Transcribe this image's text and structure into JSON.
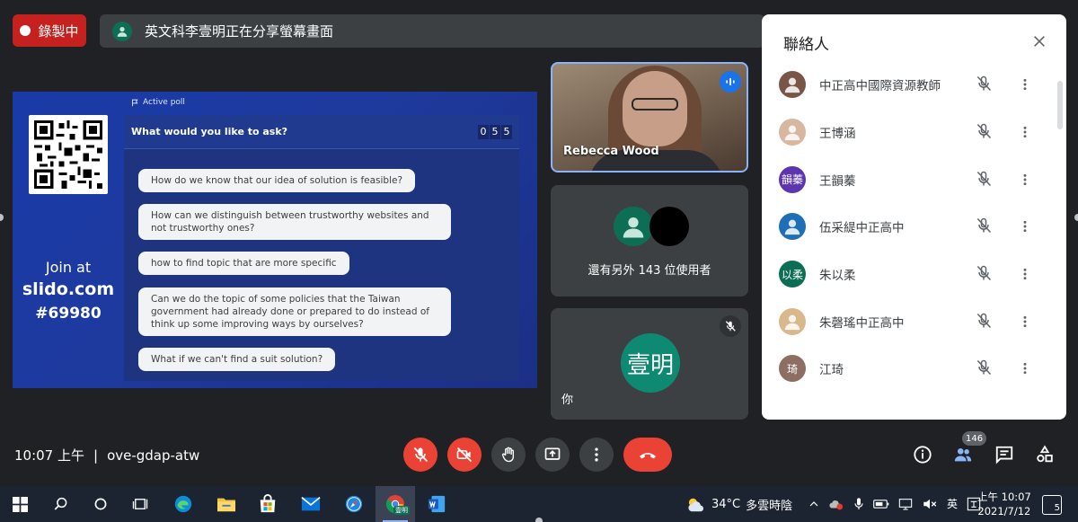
{
  "recording": {
    "label": "錄製中"
  },
  "share_banner": {
    "text": "英文科李壹明正在分享螢幕畫面"
  },
  "presentation": {
    "join_line1": "Join at",
    "join_site": "slido.com",
    "join_code": "#69980",
    "poll_tag": "Active poll",
    "question_prompt": "What would you like to ask?",
    "counter_digits": [
      "0",
      "5",
      "5"
    ],
    "questions": [
      "How do we know that our idea of solution is feasible?",
      "How can we distinguish between trustworthy websites and not trustworthy ones?",
      "how to find topic that are more specific",
      "Can we do the topic of some policies that the Taiwan government had already done or prepared to do instead of think up some improving ways by ourselves?",
      "What if we can't find a suit solution?"
    ]
  },
  "tiles": {
    "speaker_name": "Rebecca Wood",
    "others_text": "還有另外 143 位使用者",
    "you_avatar": "壹明",
    "you_label": "你"
  },
  "people_panel": {
    "title": "聯絡人",
    "people": [
      {
        "name": "中正高中國際資源教師",
        "avatar": "",
        "color": "#795548"
      },
      {
        "name": "王博涵",
        "avatar": "",
        "color": "#d7b7a0"
      },
      {
        "name": "王韻蓁",
        "avatar": "韻蓁",
        "color": "#5e35b1"
      },
      {
        "name": "伍采緹中正高中",
        "avatar": "",
        "color": "#1e6fb8"
      },
      {
        "name": "朱以柔",
        "avatar": "以柔",
        "color": "#0d6e56"
      },
      {
        "name": "朱磬瑤中正高中",
        "avatar": "",
        "color": "#d9b98c"
      },
      {
        "name": "江琦",
        "avatar": "琦",
        "color": "#8d6e63"
      }
    ]
  },
  "meeting": {
    "time": "10:07 上午",
    "separator": "|",
    "code": "ove-gdap-atw",
    "participant_count": "146"
  },
  "taskbar": {
    "chrome_badge": "壹明",
    "weather_temp": "34°C",
    "weather_text": "多雲時陰",
    "ime": "英",
    "clock_time": "上午 10:07",
    "clock_date": "2021/7/12",
    "notification_count": "5"
  }
}
